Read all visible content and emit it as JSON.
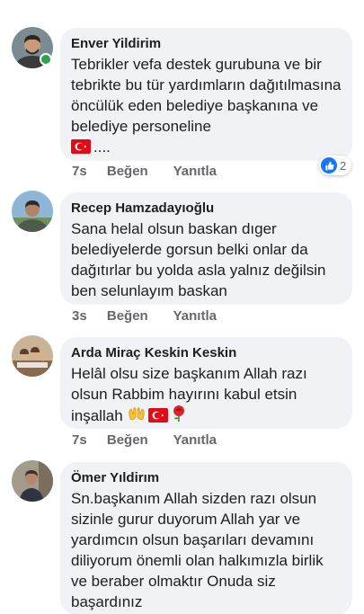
{
  "comments": [
    {
      "author": "Enver Yildirim",
      "text": "Tebrikler vefa destek gurubuna ve bir tebrikte bu tür yardımların dağıtılmasına  öncülük eden belediye başkanına ve belediye personeline",
      "text_tail": "....",
      "emoji": [
        "turkish-flag"
      ],
      "time": "7s",
      "like_label": "Beğen",
      "reply_label": "Yanıtla",
      "reaction_count": "2",
      "online": true,
      "avatar_colors": {
        "bg": "#7a8b92",
        "skin": "#c89b7b",
        "hair": "#2c2520",
        "shirt": "#3a3a3a"
      }
    },
    {
      "author": "Recep Hamzadayıoğlu",
      "text": "Sana helal olsun baskan dıger belediyelerde gorsun belki onlar da dağıtırlar bu yolda asla yalnız değilsin ben selunlayım baskan",
      "time": "3s",
      "like_label": "Beğen",
      "reply_label": "Yanıtla",
      "avatar_colors": {
        "bg": "#8fb6d8",
        "skin": "#b08466",
        "hair": "#2d2a28",
        "shirt": "#4f5b4a"
      }
    },
    {
      "author": "Arda Miraç Keskin Keskin",
      "text": "Helâl olsu size başkanım Allah razı olsun Rabbim hayırını kabul etsin inşallah",
      "emoji": [
        "open-hands",
        "turkish-flag",
        "rose"
      ],
      "time": "7s",
      "like_label": "Beğen",
      "reply_label": "Yanıtla",
      "avatar_colors": {
        "bg": "#c9b49a",
        "skin": "#d7b08d",
        "hair": "#5a3d2b",
        "shirt": "#e8e3da"
      }
    },
    {
      "author": "Ömer Yıldirım",
      "text": "Sn.başkanım Allah sizden razı olsun sizinle gurur duyorum  Allah yar ve yardımcın olsun başarıları devamını diliyorum önemli olan halkımızla birlik ve beraber olmaktır Onuda siz başardınız",
      "avatar_colors": {
        "bg": "#a39c8e",
        "skin": "#b4886a",
        "hair": "#3b3028",
        "shirt": "#2f3440"
      }
    }
  ],
  "colors": {
    "bubble": "#f0f2f5",
    "meta": "#65676b",
    "like_blue": "#1877f2",
    "online_green": "#31a24c"
  }
}
